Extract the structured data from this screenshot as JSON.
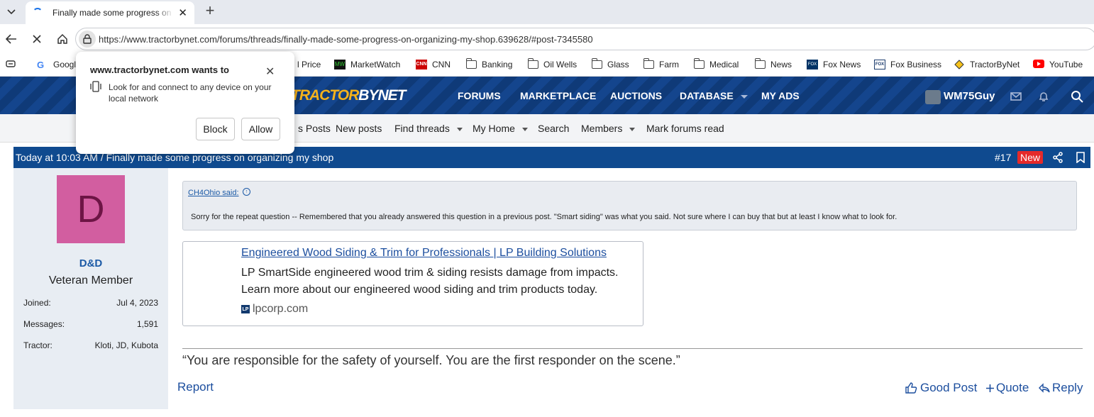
{
  "browser": {
    "tab_title": "Finally made some progress on organizing my shop",
    "url": "https://www.tractorbynet.com/forums/threads/finally-made-some-progress-on-organizing-my-shop.639628/#post-7345580"
  },
  "bookmarks": [
    {
      "label": "Google",
      "icon": "google-icon"
    },
    {
      "label": "l Price",
      "icon": ""
    },
    {
      "label": "MarketWatch",
      "icon": "marketwatch-icon"
    },
    {
      "label": "CNN",
      "icon": "cnn-icon"
    },
    {
      "label": "Banking",
      "icon": "folder-icon"
    },
    {
      "label": "Oil Wells",
      "icon": "folder-icon"
    },
    {
      "label": "Glass",
      "icon": "folder-icon"
    },
    {
      "label": "Farm",
      "icon": "folder-icon"
    },
    {
      "label": "Medical",
      "icon": "folder-icon"
    },
    {
      "label": "News",
      "icon": "folder-icon"
    },
    {
      "label": "Fox News",
      "icon": "foxnews-icon"
    },
    {
      "label": "Fox Business",
      "icon": "foxbusiness-icon"
    },
    {
      "label": "TractorByNet",
      "icon": "tractorbynet-icon"
    },
    {
      "label": "YouTube",
      "icon": "youtube-icon"
    }
  ],
  "site": {
    "logo_prefix": "TRACTOR",
    "logo_suffix": "BYNET",
    "nav": [
      "FORUMS",
      "MARKETPLACE",
      "AUCTIONS",
      "DATABASE",
      "MY ADS"
    ],
    "username": "WM75Guy",
    "subnav": [
      "s Posts",
      "New posts",
      "Find threads",
      "My Home",
      "Search",
      "Members",
      "Mark forums read"
    ]
  },
  "post": {
    "meta": "Today at 10:03 AM / Finally made some progress on organizing my shop",
    "number": "#17",
    "badge": "New",
    "poster": {
      "initial": "D",
      "name": "D&D",
      "title": "Veteran Member",
      "stats": [
        {
          "label": "Joined:",
          "value": "Jul 4, 2023"
        },
        {
          "label": "Messages:",
          "value": "1,591"
        },
        {
          "label": "Tractor:",
          "value": "Kloti, JD, Kubota"
        }
      ]
    },
    "quote": {
      "author": "CH4Ohio said:",
      "text": "Sorry for the repeat question -- Remembered that you already answered this question in a previous post. \"Smart siding\" was what you said. Not sure where I can buy that but at least I know what to look for."
    },
    "link_card": {
      "title": "Engineered Wood Siding & Trim for Professionals | LP Building Solutions",
      "description": "LP SmartSide engineered wood trim & siding resists damage from impacts. Learn more about our engineered wood siding and trim products today.",
      "domain": "lpcorp.com",
      "favicon_text": "LP"
    },
    "signature": "“You are responsible for the safety of yourself. You are the first responder on the scene.”",
    "report": "Report",
    "actions": {
      "good_post": "Good Post",
      "quote": "Quote",
      "reply": "Reply"
    }
  },
  "permission_popup": {
    "title": "www.tractorbynet.com wants to",
    "message": "Look for and connect to any device on your local network",
    "block": "Block",
    "allow": "Allow"
  },
  "colors": {
    "header_blue": "#103c7c",
    "post_header": "#0f4a8f",
    "link_blue": "#1c4e9e",
    "badge_red": "#e52a2a",
    "avatar_pink": "#d25ea0",
    "logo_yellow": "#f6b21b"
  }
}
